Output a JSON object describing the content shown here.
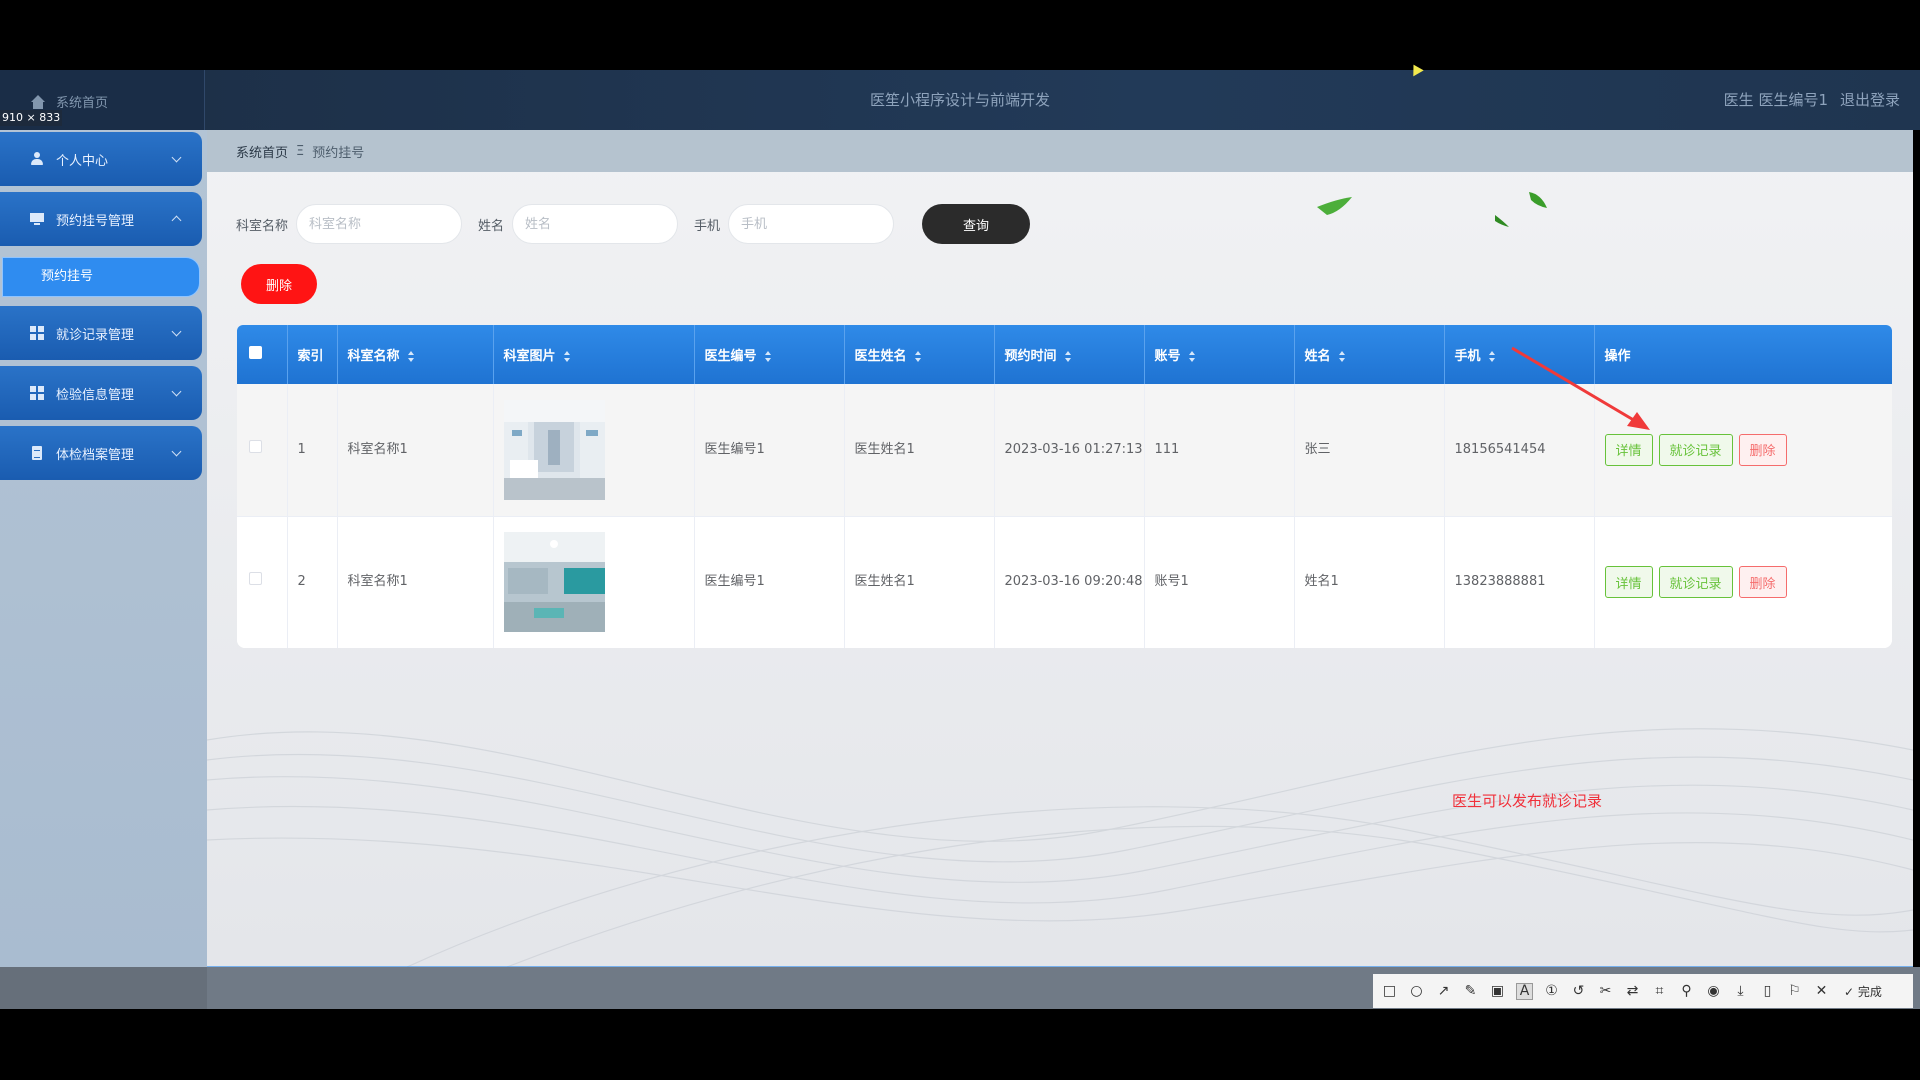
{
  "app": {
    "title": "医笙小程序设计与前端开发",
    "user_role": "医生",
    "user_name": "医生编号1",
    "logout": "退出登录",
    "home_link": "系统首页",
    "screen_size_badge": "910 × 833"
  },
  "sidebar": {
    "items": [
      {
        "label": "个人中心",
        "icon": "user-icon",
        "expanded": false
      },
      {
        "label": "预约挂号管理",
        "icon": "monitor-icon",
        "expanded": true
      },
      {
        "label": "就诊记录管理",
        "icon": "grid-icon",
        "expanded": false
      },
      {
        "label": "检验信息管理",
        "icon": "grid-icon",
        "expanded": false
      },
      {
        "label": "体检档案管理",
        "icon": "document-icon",
        "expanded": false
      }
    ],
    "active_sub": "预约挂号"
  },
  "breadcrumb": {
    "home": "系统首页",
    "separator": "Ξ",
    "current": "预约挂号"
  },
  "search": {
    "dept_label": "科室名称",
    "dept_placeholder": "科室名称",
    "name_label": "姓名",
    "name_placeholder": "姓名",
    "phone_label": "手机",
    "phone_placeholder": "手机",
    "query_button": "查询"
  },
  "actions": {
    "delete_button": "删除"
  },
  "table": {
    "headers": [
      "索引",
      "科室名称",
      "科室图片",
      "医生编号",
      "医生姓名",
      "预约时间",
      "账号",
      "姓名",
      "手机",
      "操作"
    ],
    "rows": [
      {
        "index": "1",
        "dept": "科室名称1",
        "doctor_no": "医生编号1",
        "doctor_name": "医生姓名1",
        "time": "2023-03-16 01:27:13",
        "account": "111",
        "name": "张三",
        "phone": "18156541454"
      },
      {
        "index": "2",
        "dept": "科室名称1",
        "doctor_no": "医生编号1",
        "doctor_name": "医生姓名1",
        "time": "2023-03-16 09:20:48",
        "account": "账号1",
        "name": "姓名1",
        "phone": "13823888881"
      }
    ],
    "op_detail": "详情",
    "op_record": "就诊记录",
    "op_delete": "删除"
  },
  "annotation": "医生可以发布就诊记录",
  "toolbar": {
    "done": "完成"
  },
  "colors": {
    "accent": "#1f73d2",
    "danger": "#ff1414",
    "success": "#67c23a",
    "annotation": "#f0303a"
  }
}
